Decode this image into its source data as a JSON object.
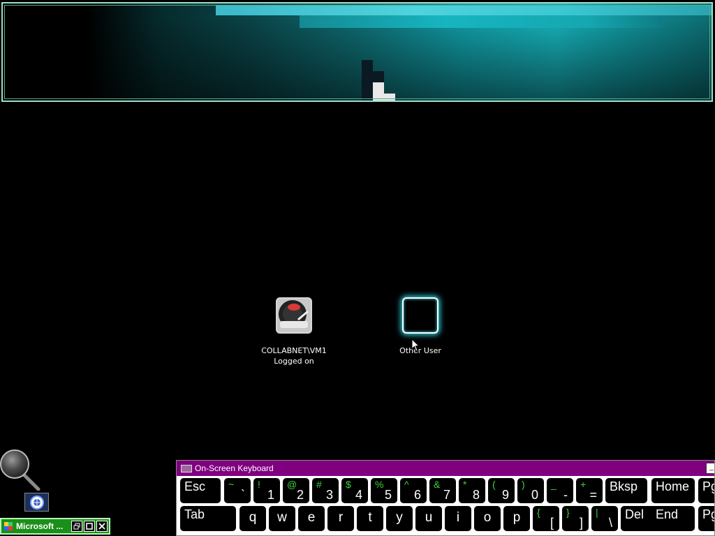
{
  "users": [
    {
      "name": "COLLABNET\\VM1",
      "status": "Logged on",
      "icon": "turntable-icon"
    },
    {
      "name": "Other User",
      "status": "",
      "icon": "blank-user-icon"
    }
  ],
  "accent": {
    "magnifier_border": "#9fe0c8",
    "osk_title": "#800080",
    "mini_window": "#1a8f1a",
    "selected_glow": "#2fd4e0",
    "key_symbol": "#3cd23c"
  },
  "mini_window": {
    "title": "Microsoft ..."
  },
  "osk": {
    "title": "On-Screen Keyboard",
    "row1": [
      {
        "main": "Esc"
      },
      {
        "upper": "~",
        "lower": "`"
      },
      {
        "upper": "!",
        "lower": "1"
      },
      {
        "upper": "@",
        "lower": "2"
      },
      {
        "upper": "#",
        "lower": "3"
      },
      {
        "upper": "$",
        "lower": "4"
      },
      {
        "upper": "%",
        "lower": "5"
      },
      {
        "upper": "^",
        "lower": "6"
      },
      {
        "upper": "&",
        "lower": "7"
      },
      {
        "upper": "*",
        "lower": "8"
      },
      {
        "upper": "(",
        "lower": "9"
      },
      {
        "upper": ")",
        "lower": "0"
      },
      {
        "upper": "_",
        "lower": "-"
      },
      {
        "upper": "+",
        "lower": "="
      },
      {
        "main": "Bksp"
      },
      {
        "main": "Home"
      },
      {
        "main": "Pg"
      }
    ],
    "row2": [
      {
        "main": "Tab"
      },
      {
        "main": "q"
      },
      {
        "main": "w"
      },
      {
        "main": "e"
      },
      {
        "main": "r"
      },
      {
        "main": "t"
      },
      {
        "main": "y"
      },
      {
        "main": "u"
      },
      {
        "main": "i"
      },
      {
        "main": "o"
      },
      {
        "main": "p"
      },
      {
        "upper": "{",
        "lower": "["
      },
      {
        "upper": "}",
        "lower": "]"
      },
      {
        "upper": "|",
        "lower": "\\"
      },
      {
        "main": "Del"
      },
      {
        "main": "End"
      },
      {
        "main": "Pg"
      }
    ]
  }
}
